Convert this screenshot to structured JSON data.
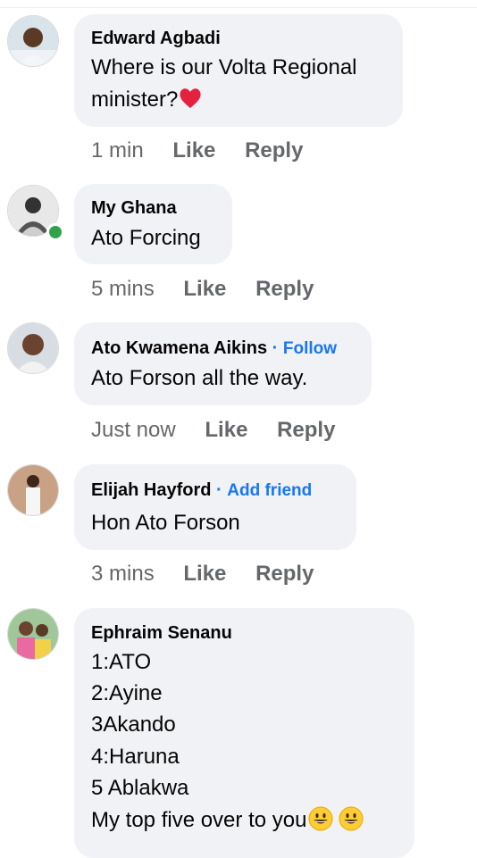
{
  "comments": [
    {
      "name": "Edward Agbadi",
      "lines": [
        "Where is our Volta Regional",
        "minister?"
      ],
      "emoji": "red-heart",
      "time": "1 min",
      "like": "Like",
      "reply": "Reply",
      "online": false
    },
    {
      "name": "My Ghana",
      "lines": [
        "Ato Forcing"
      ],
      "time": "5 mins",
      "like": "Like",
      "reply": "Reply",
      "online": true
    },
    {
      "name": "Ato Kwamena Aikins",
      "extra": "Follow",
      "lines": [
        "Ato Forson all the way."
      ],
      "time": "Just now",
      "like": "Like",
      "reply": "Reply",
      "online": false
    },
    {
      "name": "Elijah Hayford",
      "extra": "Add friend",
      "lines": [
        "Hon Ato Forson"
      ],
      "time": "3 mins",
      "like": "Like",
      "reply": "Reply",
      "online": false
    },
    {
      "name": "Ephraim Senanu",
      "lines": [
        "1:ATO",
        "2:Ayine",
        "3Akando",
        "4:Haruna",
        "5 Ablakwa",
        "My top five over to you"
      ],
      "emoji": "grinning-face x2",
      "online": false
    }
  ],
  "colors": {
    "bubble": "#f0f2f5",
    "link": "#1877f2",
    "meta": "#65676b",
    "online": "#31a24c",
    "heart": "#e4213f",
    "emoji_yellow": "#ffcc33"
  }
}
